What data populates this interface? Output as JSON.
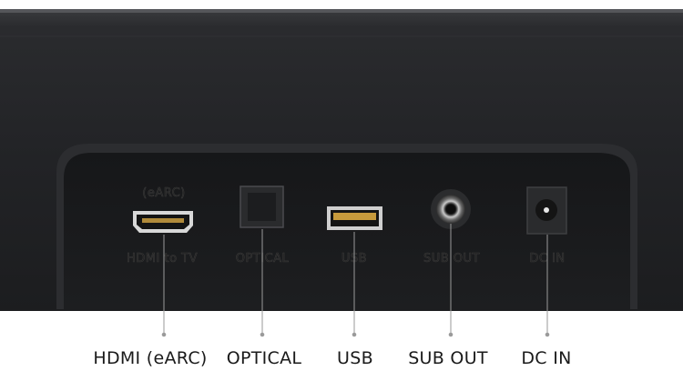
{
  "panel_print": {
    "earc_small": "(eARC)",
    "hdmi": "HDMI to TV",
    "optical": "OPTICAL",
    "usb": "USB",
    "sub_out": "SUB OUT",
    "dc_in": "DC IN"
  },
  "callouts": {
    "hdmi": "HDMI (eARC)",
    "optical": "OPTICAL",
    "usb": "USB",
    "sub_out": "SUB OUT",
    "dc_in": "DC IN"
  },
  "colors": {
    "body": "#222326",
    "panel": "#1a1b1d",
    "leader": "#9a9a9a"
  }
}
